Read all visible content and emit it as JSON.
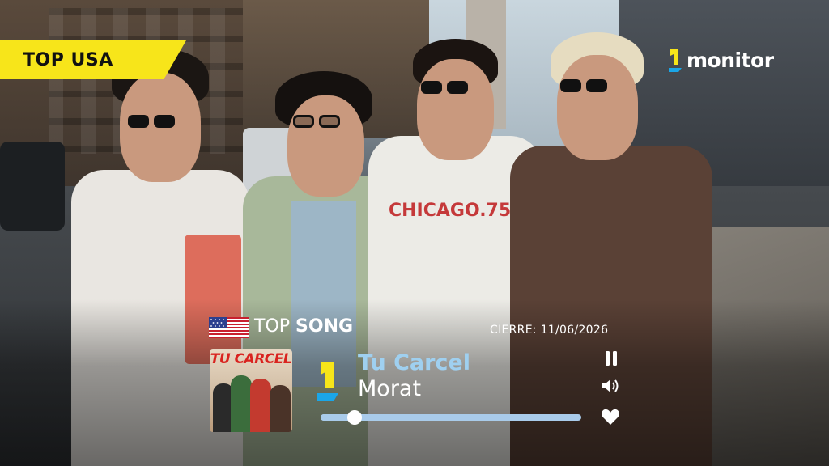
{
  "badge": {
    "label": "TOP USA"
  },
  "brand": {
    "logo_text": "monitor",
    "accent": "#f7e51a",
    "link_blue": "#1aa6e8"
  },
  "player": {
    "heading_prefix": "TOP",
    "heading_strong": "SONG",
    "closing": "CIERRE: 11/06/2026",
    "cover_title": "TU CARCEL",
    "song_title": "Tu Carcel",
    "artist": "Morat",
    "progress": 0.13,
    "icons": {
      "flag": "us-flag-icon",
      "pause": "pause-icon",
      "volume": "volume-icon",
      "like": "heart-icon"
    }
  }
}
